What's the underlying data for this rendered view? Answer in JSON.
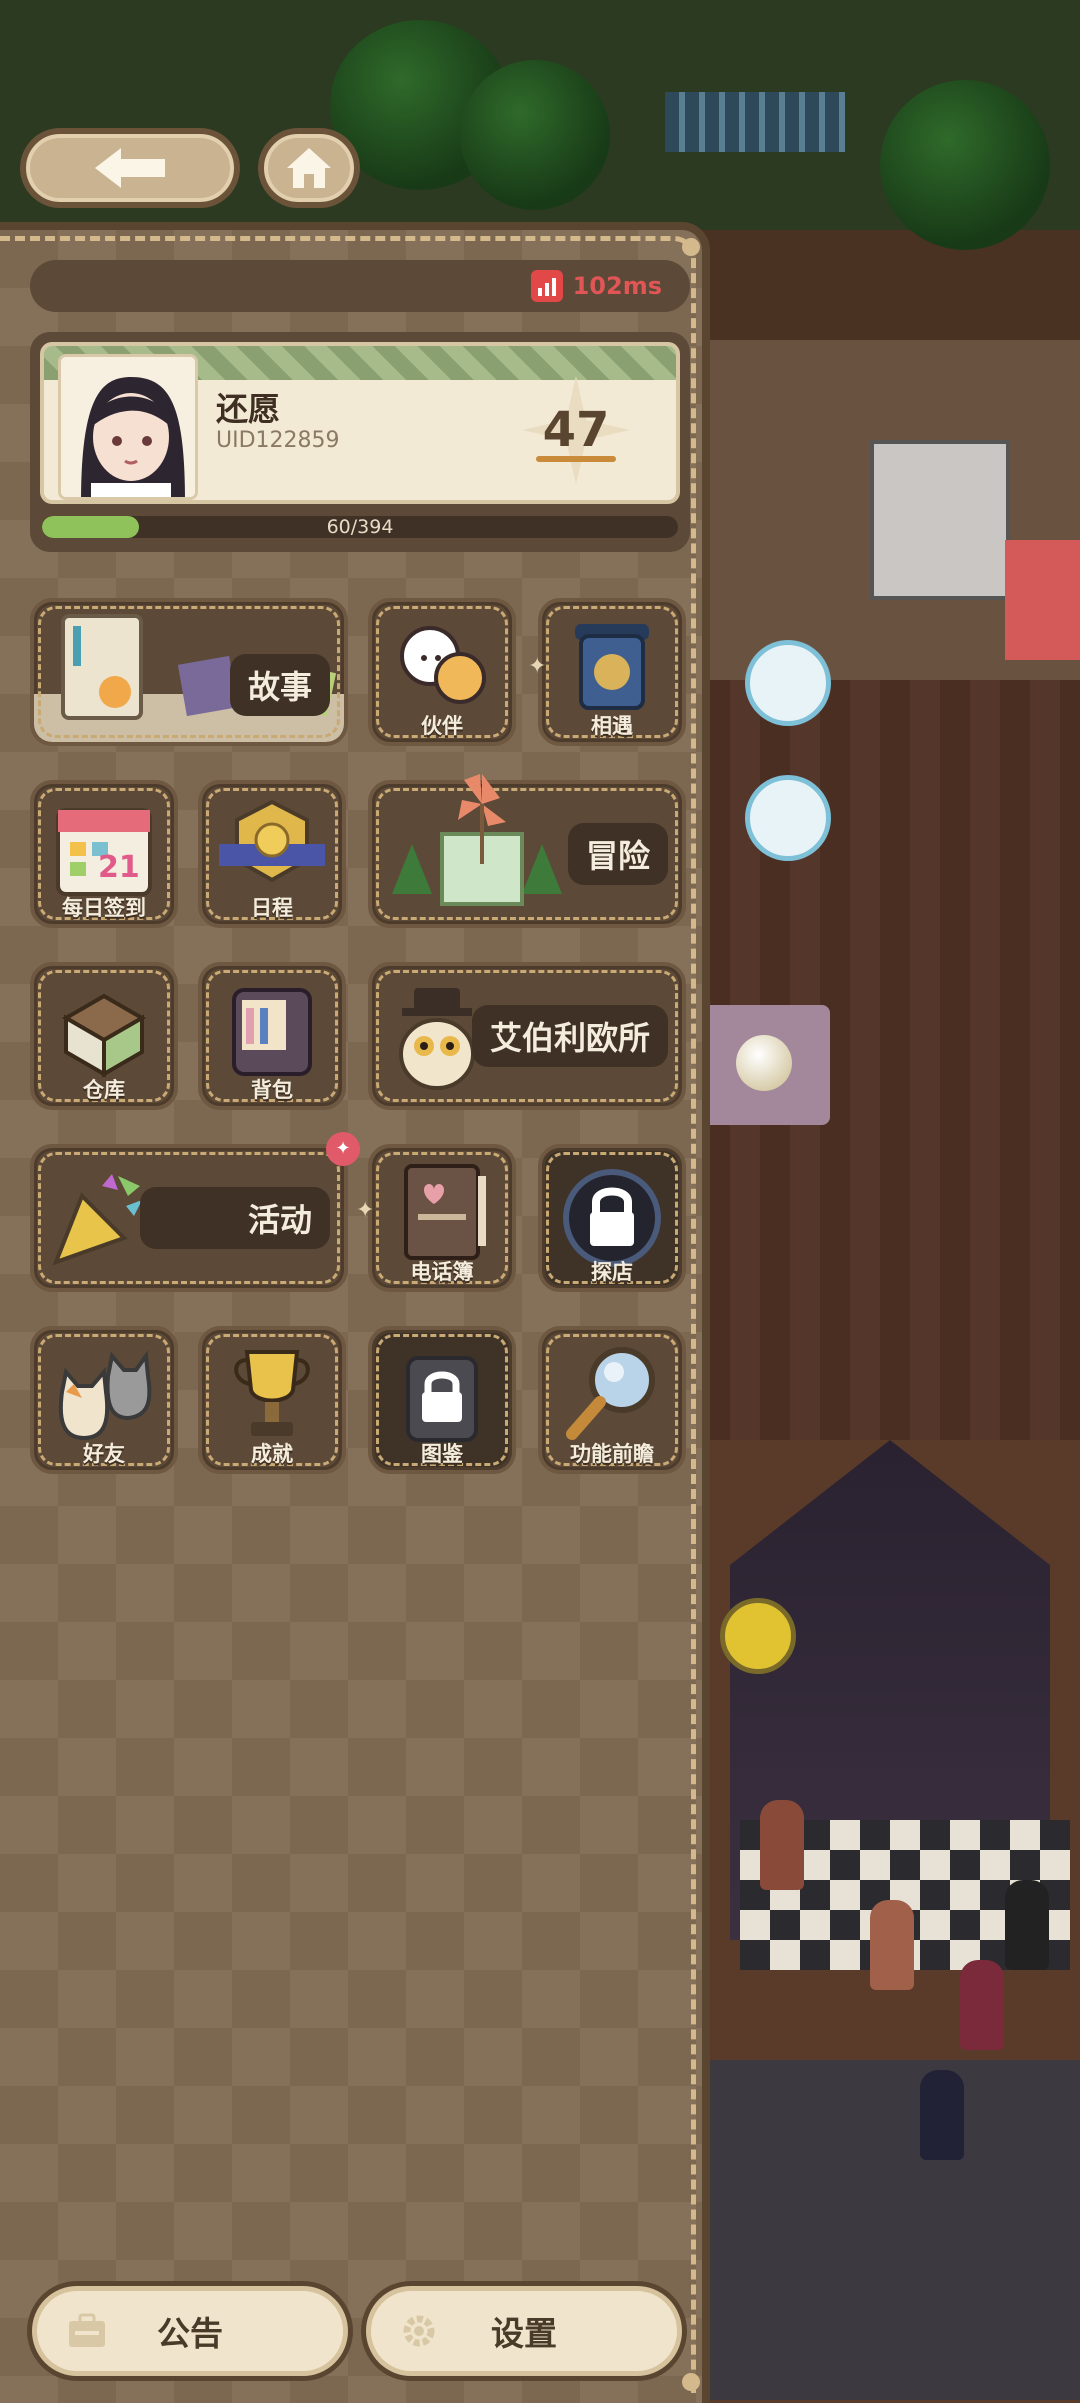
{
  "nav": {
    "back_icon": "arrow-left-icon",
    "home_icon": "home-icon"
  },
  "status": {
    "ping": "102ms",
    "ping_icon": "signal-bars-icon",
    "ping_color": "#e05555"
  },
  "profile": {
    "name": "还愿",
    "uid": "UID122859",
    "level": "47",
    "xp_text": "60/394",
    "xp_fraction": 0.152
  },
  "menu": {
    "story": "故事",
    "partner": "伙伴",
    "encounter": "相遇",
    "daily_checkin": "每日签到",
    "schedule": "日程",
    "adventure": "冒险",
    "warehouse": "仓库",
    "backpack": "背包",
    "eberio": "艾伯利欧所",
    "events": "活动",
    "phonebook": "电话簿",
    "visit_shop": "探店",
    "friends": "好友",
    "achievements": "成就",
    "codex": "图鉴",
    "preview": "功能前瞻",
    "calendar_day": "21"
  },
  "footer": {
    "notice": "公告",
    "settings": "设置"
  },
  "colors": {
    "panel": "#85705a",
    "tile": "#5c4937",
    "accent_green": "#8fc25a",
    "badge_red": "#e05a6a"
  }
}
